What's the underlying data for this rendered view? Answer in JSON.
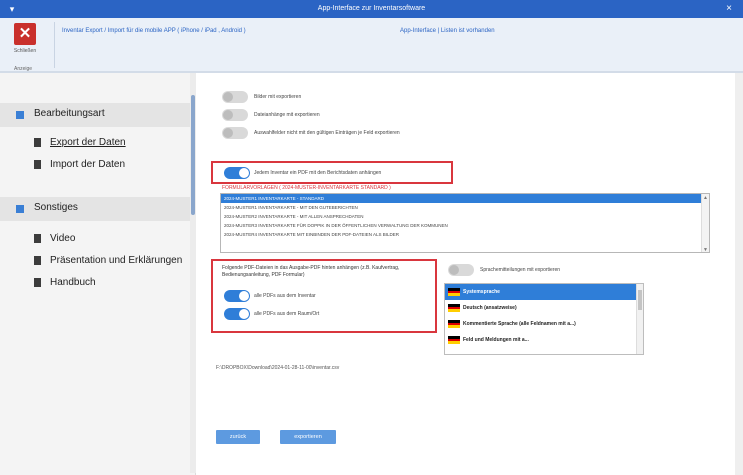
{
  "window": {
    "title": "App-Interface zur Inventarsoftware",
    "close_symbol": "×",
    "menu_symbol": "▾"
  },
  "ribbon": {
    "close_label": "Schließen",
    "group_label": "Anzeige",
    "info_left": "Inventar Export / Import für die mobile APP ( iPhone / iPad , Android )",
    "info_right": "App-Interface | Listen ist vorhanden"
  },
  "sidebar": {
    "section1": "Bearbeitungsart",
    "items1": [
      "Export der Daten",
      "Import  der Daten"
    ],
    "section2": "Sonstiges",
    "items2": [
      "Video",
      "Präsentation und Erklärungen",
      "Handbuch"
    ]
  },
  "options": [
    {
      "label": "Bilder mit exportieren",
      "on": false
    },
    {
      "label": "Dateianhänge mit exportieren",
      "on": false
    },
    {
      "label": "Auswahlfelder nicht mit den gültigen Einträgen je Feld exportieren",
      "on": false
    },
    {
      "label": "Jedem Inventar ein PDF mit den Berichtsdaten anhängen",
      "on": true
    }
  ],
  "list_header": "FORMULARVORLAGEN ( 2024-MUSTER-INVENTARKARTE STANDARD )",
  "report_list": [
    "2024-MUSTER1 INVENTARKARTE - STANDARD",
    "2024-MUSTER1 INVENTARKARTE - MIT DEN GUTEBERICHTEN",
    "2024-MUSTER2 INVENTARKARTE - MIT ALLEN ANSPRECHDATEN",
    "2024-MUSTER3 INVENTARKARTE FÜR DOPPIK IN DER ÖFFENTLICHEN VERWALTUNG DER KOMMUNEN",
    "2024-MUSTER4 INVENTARKARTE MIT EINBINDEN DER PDF-DATEIEN ALS BILDER"
  ],
  "attach": {
    "text": "Folgende PDF-Dateien in das Ausgabe-PDF hinten anhängen (z.B. Kaufvertrag, Bedienungsanleitung, PDF Formular)",
    "toggle1": "alle PDFs aus dem Inventar",
    "toggle2": "alle PDFs aus dem Raum/Ort"
  },
  "lang": {
    "toggle_label": "Sprachemitteilungen mit exportieren",
    "items": [
      "Systemsprache",
      "Deutsch (ansatzweise)",
      "Kommentierte Sprache (alle Feldnamen mit a...)",
      "Feld und Meldungen mit a..."
    ]
  },
  "path": "F:\\DROPBOX\\Download\\2024-01-28-11-00\\inventar.csv",
  "buttons": {
    "back": "zurück",
    "export": "exportieren"
  },
  "colors": {
    "accent": "#2f7ed8",
    "title_bar": "#2b64c4",
    "highlight_border": "#d9363e",
    "close_red": "#c9302c"
  }
}
